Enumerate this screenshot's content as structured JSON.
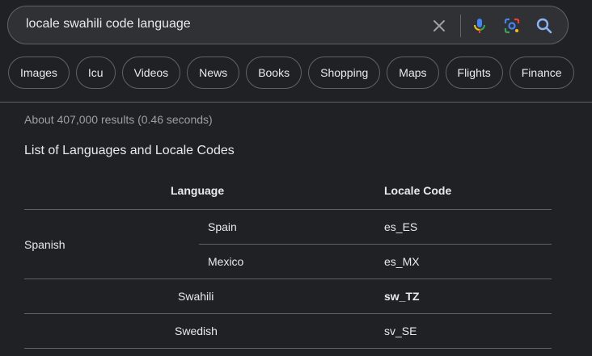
{
  "search": {
    "query": "locale swahili code language"
  },
  "icons": {
    "clear": "close-icon",
    "voice": "mic-icon",
    "lens": "lens-icon",
    "search": "search-icon"
  },
  "chips": [
    "Images",
    "Icu",
    "Videos",
    "News",
    "Books",
    "Shopping",
    "Maps",
    "Flights",
    "Finance"
  ],
  "results": {
    "stats": "About 407,000 results (0.46 seconds)"
  },
  "table": {
    "title": "List of Languages and Locale Codes",
    "headers": {
      "language": "Language",
      "locale": "Locale Code"
    },
    "rows": {
      "spanish": {
        "language": "Spanish",
        "sub": [
          {
            "region": "Spain",
            "code": "es_ES"
          },
          {
            "region": "Mexico",
            "code": "es_MX"
          }
        ]
      },
      "swahili": {
        "language": "Swahili",
        "code": "sw_TZ"
      },
      "swedish": {
        "language": "Swedish",
        "code": "sv_SE"
      }
    }
  },
  "colors": {
    "background": "#202124",
    "surface": "#303134",
    "border": "#5f6368",
    "text": "#e8eaed",
    "muted": "#9aa0a6"
  }
}
